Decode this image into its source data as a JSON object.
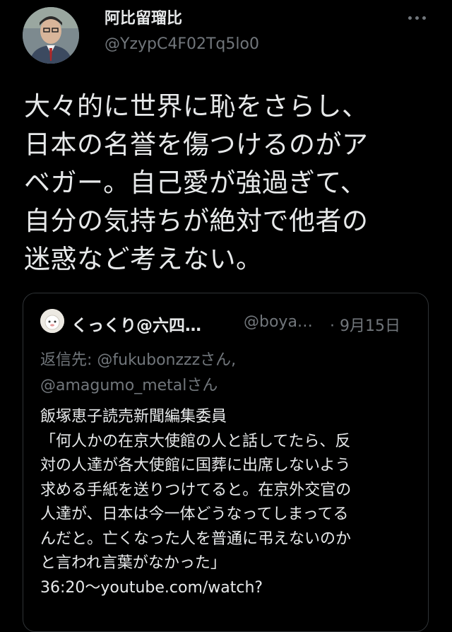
{
  "author": {
    "name": "阿比留瑠比",
    "handle": "@YzypC4F02Tq5lo0",
    "avatar_icon": "profile-photo-icon",
    "more_icon": "more-dots-icon"
  },
  "tweet": {
    "text": "大々的に世界に恥をさらし、\n日本の名誉を傷つけるのがア\nベガー。自己愛が強過ぎて、\n自分の気持ちが絶対で他者の\n迷惑など考えない。"
  },
  "quoted": {
    "name": "くっくり@六四…",
    "handle": "@boya…",
    "date": "· 9月15日",
    "reply_prefix": "返信先: ",
    "reply_to_1": "@fukubonzzzさん,",
    "reply_to_2": "@amagumo_metalさん",
    "body": "飯塚恵子読売新聞編集委員\n「何人かの在京大使館の人と話してたら、反\n対の人達が各大使館に国葬に出席しないよう\n求める手紙を送りつけてると。在京外交官の\n人達が、日本は今一体どうなってしまってる\nんだと。亡くなった人を普通に弔えないのか\nと言われ言葉がなかった」\n36:20〜youtube.com/watch?"
  }
}
